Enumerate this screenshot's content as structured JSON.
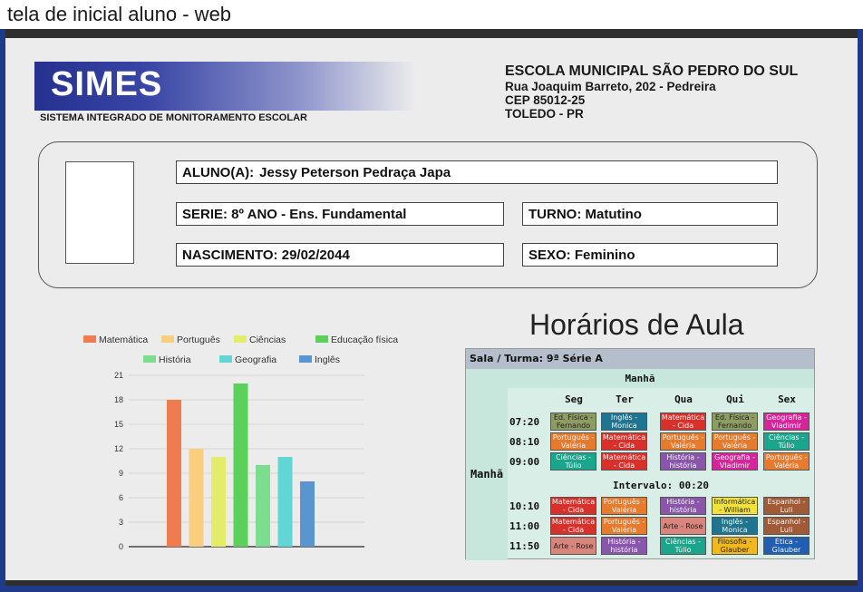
{
  "window": {
    "title": "tela de inicial aluno - web"
  },
  "header": {
    "logo": "SIMES",
    "logo_subtitle": "SISTEMA INTEGRADO DE MONITORAMENTO ESCOLAR",
    "school_name": "ESCOLA MUNICIPAL SÃO PEDRO DO SUL",
    "address_line1": "Rua Joaquim Barreto, 202 - Pedreira",
    "address_line2": "CEP 85012-25",
    "address_line3": "TOLEDO - PR"
  },
  "student": {
    "aluno_label": "ALUNO(A):",
    "aluno": "Jessy Peterson Pedraça Japa",
    "serie": "SERIE: 8º ANO - Ens. Fundamental",
    "turno": "TURNO: Matutino",
    "nascimento": "NASCIMENTO: 29/02/2044",
    "sexo": "SEXO: Feminino"
  },
  "chart_data": {
    "type": "bar",
    "categories": [
      "Matemática",
      "Português",
      "Ciências",
      "Educação física",
      "História",
      "Geografia",
      "Inglês"
    ],
    "values": [
      18,
      12,
      11,
      20,
      10,
      11,
      8
    ],
    "colors": [
      "#f07b4e",
      "#f9cf7f",
      "#e3ed6a",
      "#5bd05a",
      "#7bdd8d",
      "#62d5d5",
      "#5b95d0"
    ],
    "ylim": [
      0,
      21
    ],
    "yticks": [
      "21",
      "18",
      "15",
      "12",
      "9",
      "6",
      "3",
      "0"
    ],
    "legend_position": "top",
    "grid": true
  },
  "schedule": {
    "title": "Horários de Aula",
    "header": "Sala / Turma: 9ª Série A",
    "shift_row": "Manhã",
    "side_label": "Manhã",
    "days": [
      "Seg",
      "Ter",
      "Qua",
      "Qui",
      "Sex"
    ],
    "times": [
      "07:20",
      "08:10",
      "09:00",
      "10:10",
      "11:00",
      "11:50"
    ],
    "intervalo": "Intervalo: 00:20",
    "rows": [
      [
        {
          "text": "Ed. Física - Fernando",
          "color": "#8c9c63"
        },
        {
          "text": "Inglês - Monica",
          "color": "#1f7590"
        },
        {
          "text": "Matemática - Cida",
          "color": "#d8312c"
        },
        {
          "text": "Ed. Física - Fernando",
          "color": "#8c9c63"
        },
        {
          "text": "Geografia - Vladimir",
          "color": "#d6249a"
        }
      ],
      [
        {
          "text": "Português - Valéria",
          "color": "#e67a2d"
        },
        {
          "text": "Matemática - Cida",
          "color": "#d8312c"
        },
        {
          "text": "Português - Valéria",
          "color": "#e67a2d"
        },
        {
          "text": "Português - Valéria",
          "color": "#e67a2d"
        },
        {
          "text": "Ciências - Túlio",
          "color": "#1aa58c"
        }
      ],
      [
        {
          "text": "Ciências - Túlio",
          "color": "#1aa58c"
        },
        {
          "text": "Matemática - Cida",
          "color": "#d8312c"
        },
        {
          "text": "História - história",
          "color": "#8a56ac"
        },
        {
          "text": "Geografia - Vladimir",
          "color": "#d6249a"
        },
        {
          "text": "Português - Valéria",
          "color": "#e67a2d"
        }
      ],
      [
        {
          "text": "Matemática - Cida",
          "color": "#d8312c"
        },
        {
          "text": "Português - Valéria",
          "color": "#e67a2d"
        },
        {
          "text": "História - história",
          "color": "#8a56ac"
        },
        {
          "text": "Informática - William",
          "color": "#f3e23c"
        },
        {
          "text": "Espanhol - Luli",
          "color": "#a05a36"
        }
      ],
      [
        {
          "text": "Matemática - Cida",
          "color": "#d8312c"
        },
        {
          "text": "Português - Valéria",
          "color": "#e67a2d"
        },
        {
          "text": "Arte - Rose",
          "color": "#d9847c"
        },
        {
          "text": "Inglês - Monica",
          "color": "#1f7590"
        },
        {
          "text": "Espanhol - Luli",
          "color": "#a05a36"
        }
      ],
      [
        {
          "text": "Arte - Rose",
          "color": "#d9847c"
        },
        {
          "text": "História - história",
          "color": "#8a56ac"
        },
        {
          "text": "Ciências - Túlio",
          "color": "#1aa58c"
        },
        {
          "text": "Filosofia - Glauber",
          "color": "#f2b91e"
        },
        {
          "text": "Ética - Glauber",
          "color": "#1e5fb4"
        }
      ]
    ]
  }
}
